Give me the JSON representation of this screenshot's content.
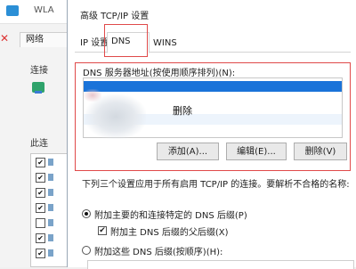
{
  "background_window": {
    "title": "WLA",
    "tab": "网络",
    "connect_label": "连接",
    "items_label": "此连",
    "close_glyph": "✕",
    "items": [
      {
        "checked": true
      },
      {
        "checked": true
      },
      {
        "checked": true
      },
      {
        "checked": true
      },
      {
        "checked": false
      },
      {
        "checked": true
      },
      {
        "checked": true
      }
    ]
  },
  "dialog": {
    "title": "高级 TCP/IP 设置",
    "tabs": [
      {
        "label": "IP 设置",
        "active": false
      },
      {
        "label": "DNS",
        "active": true
      },
      {
        "label": "WINS",
        "active": false
      }
    ],
    "dns_servers_label": "DNS 服务器地址(按使用顺序排列)(N):",
    "popup_text": "删除",
    "buttons": {
      "add": "添加(A)...",
      "edit": "编辑(E)...",
      "remove": "删除(V)"
    },
    "description": "下列三个设置应用于所有启用 TCP/IP 的连接。要解析不合格的名称:",
    "options": {
      "primary_suffix": "附加主要的和连接特定的 DNS 后缀(P)",
      "parent_suffix": "附加主 DNS 后缀的父后缀(X)",
      "parent_suffix_checked": true,
      "these_suffixes": "附加这些 DNS 后缀(按顺序)(H):",
      "selected": "primary_suffix"
    }
  },
  "colors": {
    "highlight_red": "#e04a4a",
    "selection_blue": "#1a73d9"
  }
}
